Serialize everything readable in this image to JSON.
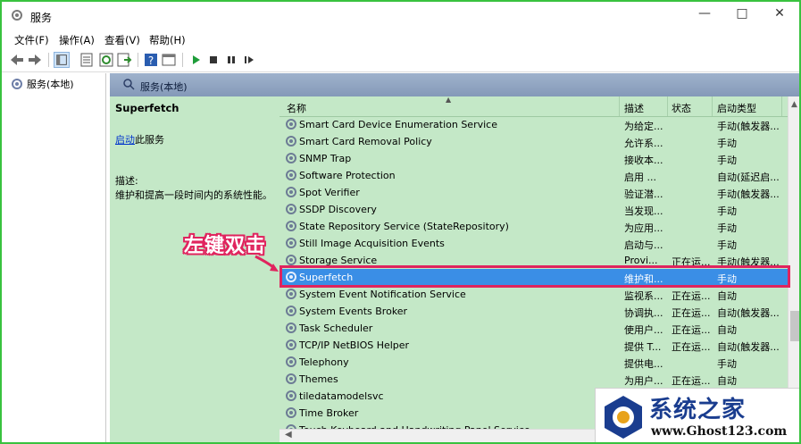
{
  "window": {
    "title": "服务",
    "min": "—",
    "max": "□",
    "close": "✕"
  },
  "menu": [
    "文件(F)",
    "操作(A)",
    "查看(V)",
    "帮助(H)"
  ],
  "tree": {
    "root": "服务(本地)"
  },
  "header": {
    "title": "服务(本地)"
  },
  "detail": {
    "service_name": "Superfetch",
    "start_link": "启动",
    "start_suffix": "此服务",
    "desc_label": "描述:",
    "desc_text": "维护和提高一段时间内的系统性能。"
  },
  "columns": {
    "name": "名称",
    "desc": "描述",
    "status": "状态",
    "start": "启动类型"
  },
  "services": [
    {
      "name": "Smart Card Device Enumeration Service",
      "desc": "为给定...",
      "status": "",
      "start": "手动(触发器..."
    },
    {
      "name": "Smart Card Removal Policy",
      "desc": "允许系...",
      "status": "",
      "start": "手动"
    },
    {
      "name": "SNMP Trap",
      "desc": "接收本...",
      "status": "",
      "start": "手动"
    },
    {
      "name": "Software Protection",
      "desc": "启用 ...",
      "status": "",
      "start": "自动(延迟启..."
    },
    {
      "name": "Spot Verifier",
      "desc": "验证潜...",
      "status": "",
      "start": "手动(触发器..."
    },
    {
      "name": "SSDP Discovery",
      "desc": "当发现...",
      "status": "",
      "start": "手动"
    },
    {
      "name": "State Repository Service (StateRepository)",
      "desc": "为应用...",
      "status": "",
      "start": "手动"
    },
    {
      "name": "Still Image Acquisition Events",
      "desc": "启动与...",
      "status": "",
      "start": "手动"
    },
    {
      "name": "Storage Service",
      "desc": "Provi...",
      "status": "正在运...",
      "start": "手动(触发器..."
    },
    {
      "name": "Superfetch",
      "desc": "维护和...",
      "status": "",
      "start": "手动"
    },
    {
      "name": "System Event Notification Service",
      "desc": "监视系...",
      "status": "正在运...",
      "start": "自动"
    },
    {
      "name": "System Events Broker",
      "desc": "协调执...",
      "status": "正在运...",
      "start": "自动(触发器..."
    },
    {
      "name": "Task Scheduler",
      "desc": "使用户...",
      "status": "正在运...",
      "start": "自动"
    },
    {
      "name": "TCP/IP NetBIOS Helper",
      "desc": "提供 T...",
      "status": "正在运...",
      "start": "自动(触发器..."
    },
    {
      "name": "Telephony",
      "desc": "提供电...",
      "status": "",
      "start": "手动"
    },
    {
      "name": "Themes",
      "desc": "为用户...",
      "status": "正在运...",
      "start": "自动"
    },
    {
      "name": "tiledatamodelsvc",
      "desc": "",
      "status": "",
      "start": ""
    },
    {
      "name": "Time Broker",
      "desc": "",
      "status": "",
      "start": ""
    },
    {
      "name": "Touch Keyboard and Handwriting Panel Service",
      "desc": "",
      "status": "",
      "start": ""
    }
  ],
  "selected_index": 9,
  "annotation": "左键双击",
  "watermark": {
    "title": "系统之家",
    "url": "www.Ghost123.com"
  },
  "colors": {
    "accent_pink": "#e0245e",
    "selection": "#3a8ee6",
    "pane_bg": "#c4e8c7",
    "window_border": "#39c23f"
  }
}
